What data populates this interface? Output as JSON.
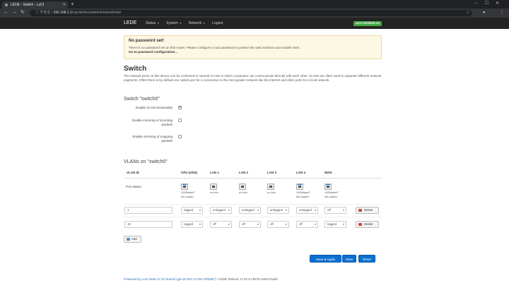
{
  "browser": {
    "tab_title": "LEDE - Switch - LuCI",
    "new_tab": "+",
    "insecure_label": "不安全",
    "url_host": "192.168.1.1",
    "url_path": "/cgi-bin/luci/admin/network/vlan"
  },
  "header": {
    "brand": "LEDE",
    "menu": [
      "Status",
      "System",
      "Network",
      "Logout"
    ],
    "auto_refresh": "AUTO REFRESH ON"
  },
  "alert": {
    "title": "No password set!",
    "text": "There is no password set on this router. Please configure a root password to protect the web interface and enable SSH.",
    "link": "Go to password configuration..."
  },
  "page": {
    "title": "Switch",
    "description": "The network ports on this device can be combined to several VLANs in which computers can communicate directly with each other. VLANs are often used to separate different network segments. Often there is by default one Uplink port for a connection to the next greater network like the internet and other ports for a local network."
  },
  "switch_section": {
    "title": "Switch \"switch0\"",
    "options": [
      {
        "label": "Enable VLAN functionality",
        "checked": true
      },
      {
        "label": "Enable mirroring of incoming packets",
        "checked": false
      },
      {
        "label": "Enable mirroring of outgoing packets",
        "checked": false
      }
    ]
  },
  "vlans": {
    "title": "VLANs on \"switch0\"",
    "columns": [
      "VLAN ID",
      "CPU (eth0)",
      "LAN 1",
      "LAN 2",
      "LAN 3",
      "LAN 4",
      "WAN"
    ],
    "port_status_label": "Port status:",
    "ports": [
      {
        "line1": "1000baseT",
        "line2": "full-duplex",
        "up": true
      },
      {
        "line1": "no link",
        "line2": "",
        "up": false
      },
      {
        "line1": "no link",
        "line2": "",
        "up": false
      },
      {
        "line1": "no link",
        "line2": "",
        "up": false
      },
      {
        "line1": "1000baseT",
        "line2": "full-duplex",
        "up": true
      },
      {
        "line1": "1000baseT",
        "line2": "full-duplex",
        "up": true
      }
    ],
    "rows": [
      {
        "vid": "1",
        "values": [
          "tagged",
          "untagged",
          "untagged",
          "untagged",
          "untagged",
          "off"
        ]
      },
      {
        "vid": "10",
        "values": [
          "tagged",
          "off",
          "off",
          "off",
          "off",
          "tagged"
        ]
      }
    ],
    "delete_label": "Delete",
    "add_label": "Add"
  },
  "actions": {
    "save_apply": "Save & Apply",
    "save": "Save",
    "reset": "Reset"
  },
  "footer": {
    "powered": "Powered by LuCI lede-17.01 branch (git-18.201.27126-7bf0367)",
    "release": " / LEDE Reboot 17.01.6 r3979-2252731af4"
  }
}
